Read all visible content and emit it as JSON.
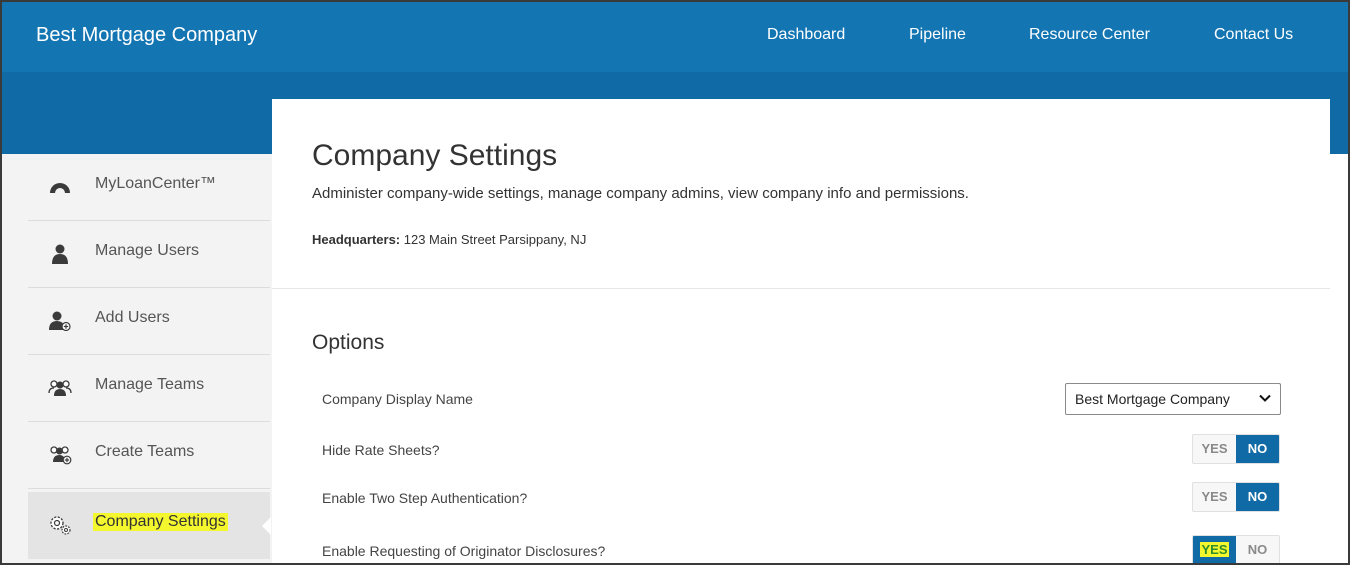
{
  "navbar": {
    "brand": "Best Mortgage Company",
    "links": [
      "Dashboard",
      "Pipeline",
      "Resource Center",
      "Contact Us"
    ]
  },
  "sidebar": {
    "items": [
      {
        "label": "MyLoanCenter™",
        "icon": "gauge-icon"
      },
      {
        "label": "Manage Users",
        "icon": "user-icon"
      },
      {
        "label": "Add Users",
        "icon": "add-user-icon"
      },
      {
        "label": "Manage Teams",
        "icon": "team-icon"
      },
      {
        "label": "Create Teams",
        "icon": "add-team-icon"
      },
      {
        "label": "Company Settings",
        "icon": "gears-icon",
        "active": true
      }
    ]
  },
  "main": {
    "title": "Company Settings",
    "subtitle": "Administer company-wide settings, manage company admins, view company info and permissions.",
    "headquarters_label": "Headquarters:",
    "headquarters_value": " 123 Main Street Parsippany, NJ",
    "options_title": "Options",
    "options": {
      "display_name": {
        "label": "Company Display Name",
        "value": "Best Mortgage Company"
      },
      "hide_rate_sheets": {
        "label": "Hide Rate Sheets?",
        "yes": "YES",
        "no": "NO",
        "selected": "NO"
      },
      "two_step": {
        "label": "Enable Two Step Authentication?",
        "yes": "YES",
        "no": "NO",
        "selected": "NO"
      },
      "originator_disclosures": {
        "label": "Enable Requesting of Originator Disclosures?",
        "yes": "YES",
        "no": "NO",
        "selected": "YES"
      }
    }
  },
  "colors": {
    "nav_blue": "#1475b3",
    "band_blue": "#106aa5",
    "toggle_on": "#0f6aa6",
    "highlight": "#f4f72e"
  }
}
